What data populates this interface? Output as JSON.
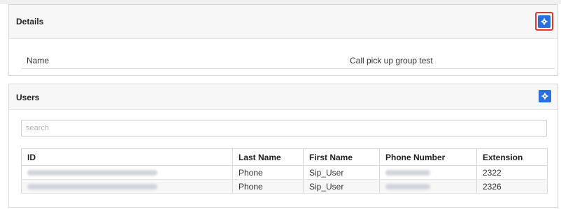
{
  "details": {
    "title": "Details",
    "settings_icon": "gear-icon",
    "rows": [
      {
        "label": "Name",
        "value": "Call pick up group test"
      }
    ]
  },
  "users": {
    "title": "Users",
    "settings_icon": "gear-icon",
    "search_placeholder": "search",
    "columns": [
      "ID",
      "Last Name",
      "First Name",
      "Phone Number",
      "Extension"
    ],
    "rows": [
      {
        "id": "",
        "last_name": "Phone",
        "first_name": "Sip_User",
        "phone_number": "",
        "extension": "2322"
      },
      {
        "id": "",
        "last_name": "Phone",
        "first_name": "Sip_User",
        "phone_number": "",
        "extension": "2326"
      }
    ]
  },
  "colors": {
    "accent": "#2a6fdb",
    "highlight": "#e8342e",
    "header_bg": "#f7f7f7",
    "border": "#d6d6d6"
  }
}
